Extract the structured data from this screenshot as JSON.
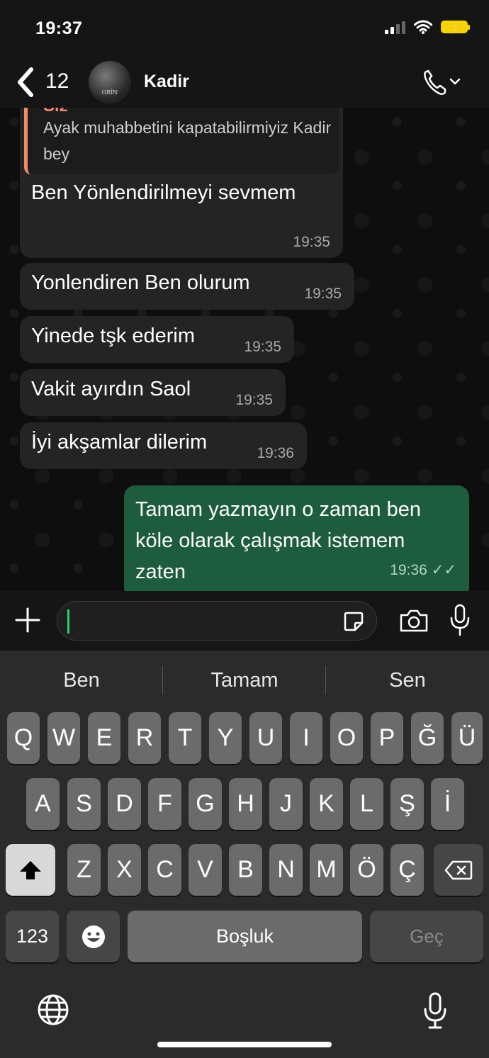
{
  "status_bar": {
    "time": "19:37"
  },
  "header": {
    "back_count": "12",
    "contact_name": "Kadir",
    "avatar_text": "GRİN"
  },
  "messages": [
    {
      "direction": "in",
      "quote_author": "Siz",
      "quote_text": "Ayak muhabbetini kapatabilirmiyiz Kadir bey",
      "text": "Ben Yönlendirilmeyi sevmem",
      "time": "19:35"
    },
    {
      "direction": "in",
      "text": "Yonlendiren Ben olurum",
      "time": "19:35"
    },
    {
      "direction": "in",
      "text": "Yinede tşk ederim",
      "time": "19:35"
    },
    {
      "direction": "in",
      "text": "Vakit ayırdın Saol",
      "time": "19:35"
    },
    {
      "direction": "in",
      "text": "İyi akşamlar dilerim",
      "time": "19:36"
    },
    {
      "direction": "out",
      "text_lines": [
        "Tamam yazmayın o zaman ben",
        "köle olarak çalışmak istemem",
        "zaten"
      ],
      "time": "19:36",
      "read_ticks": "✓✓"
    }
  ],
  "keyboard": {
    "suggestions": [
      "Ben",
      "Tamam",
      "Sen"
    ],
    "row1": [
      "Q",
      "W",
      "E",
      "R",
      "T",
      "Y",
      "U",
      "I",
      "O",
      "P",
      "Ğ",
      "Ü"
    ],
    "row2": [
      "A",
      "S",
      "D",
      "F",
      "G",
      "H",
      "J",
      "K",
      "L",
      "Ş",
      "İ"
    ],
    "row3": [
      "Z",
      "X",
      "C",
      "V",
      "B",
      "N",
      "M",
      "Ö",
      "Ç"
    ],
    "numbers_label": "123",
    "space_label": "Boşluk",
    "go_label": "Geç"
  },
  "icons": {
    "back": "chevron-left-icon",
    "call": "phone-icon",
    "plus": "plus-icon",
    "sticker": "sticker-icon",
    "camera": "camera-icon",
    "mic": "microphone-icon",
    "shift": "shift-icon",
    "delete": "backspace-icon",
    "emoji": "emoji-icon",
    "globe": "globe-icon"
  },
  "colors": {
    "outgoing_bubble": "#1d5c3f",
    "incoming_bubble": "#242424",
    "quote_accent": "#f28a6a",
    "battery": "#f5d400"
  }
}
